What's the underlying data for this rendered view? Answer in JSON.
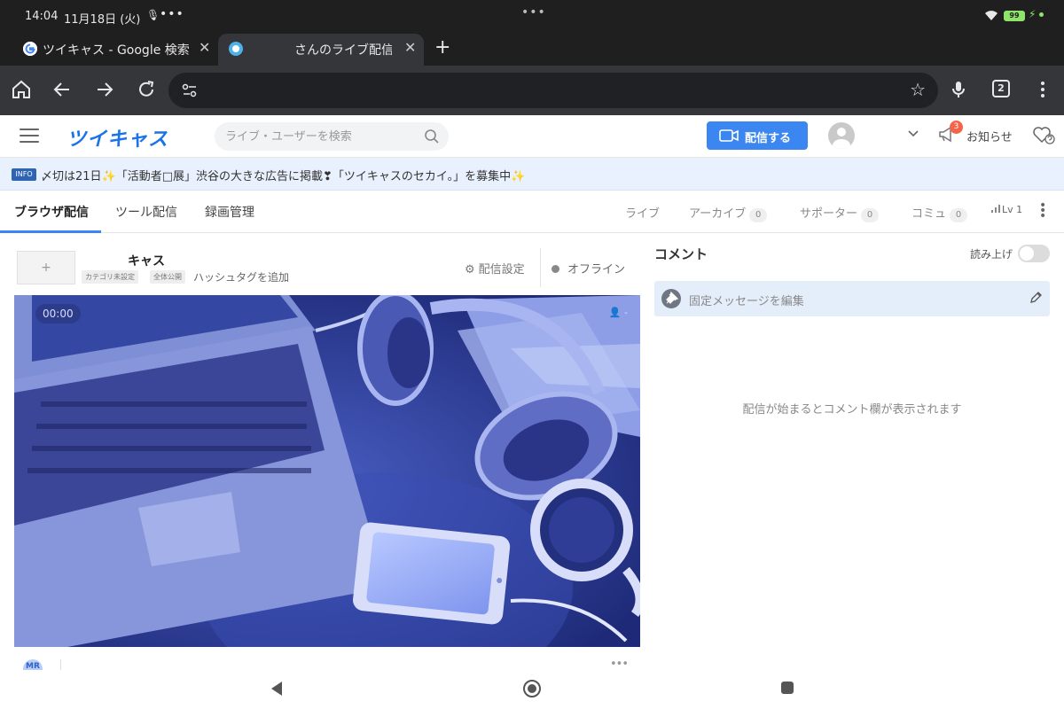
{
  "status_bar": {
    "time": "14:04",
    "date": "11月18日 (火)",
    "battery": "99"
  },
  "browser": {
    "tabs": [
      {
        "title": "ツイキャス - Google 検索"
      },
      {
        "title": "さんのライブ配信"
      }
    ],
    "address": "",
    "tab_count": "2"
  },
  "header": {
    "logo": "ツイキャス",
    "search_placeholder": "ライブ・ユーザーを検索",
    "broadcast_label": "配信する",
    "notification_count": "3",
    "notification_label": "お知らせ"
  },
  "info_banner": {
    "tag": "INFO",
    "text": "〆切は21日✨「活動者□展」渋谷の大きな広告に掲載❣「ツイキャスのセカイ。」を募集中✨"
  },
  "subnav": {
    "tabs": [
      {
        "label": "ブラウザ配信"
      },
      {
        "label": "ツール配信"
      },
      {
        "label": "録画管理"
      }
    ],
    "right": [
      {
        "label": "ライブ"
      },
      {
        "label": "アーカイブ",
        "count": "0"
      },
      {
        "label": "サポーター",
        "count": "0"
      },
      {
        "label": "コミュ",
        "count": "0"
      },
      {
        "label": "Lv 1"
      }
    ]
  },
  "cast": {
    "add_label": "+",
    "title": "キャス",
    "chips": [
      "カテゴリ未設定",
      "全体公開"
    ],
    "hashtag_placeholder": "ハッシュタグを追加",
    "settings_label": "配信設定",
    "status_label": "オフライン",
    "timer": "00:00",
    "viewer_count": "-",
    "mini_avatar_initials": "MR"
  },
  "comments": {
    "title": "コメント",
    "read_aloud_label": "読み上げ",
    "read_aloud_on": false,
    "pinned_placeholder": "固定メッセージを編集",
    "empty_message": "配信が始まるとコメント欄が表示されます"
  },
  "colors": {
    "brand": "#1a73e8",
    "primary_button": "#3b86f0",
    "badge": "#f2654a",
    "banner_bg": "#e8f1fd",
    "chrome_dark": "#35363a"
  }
}
